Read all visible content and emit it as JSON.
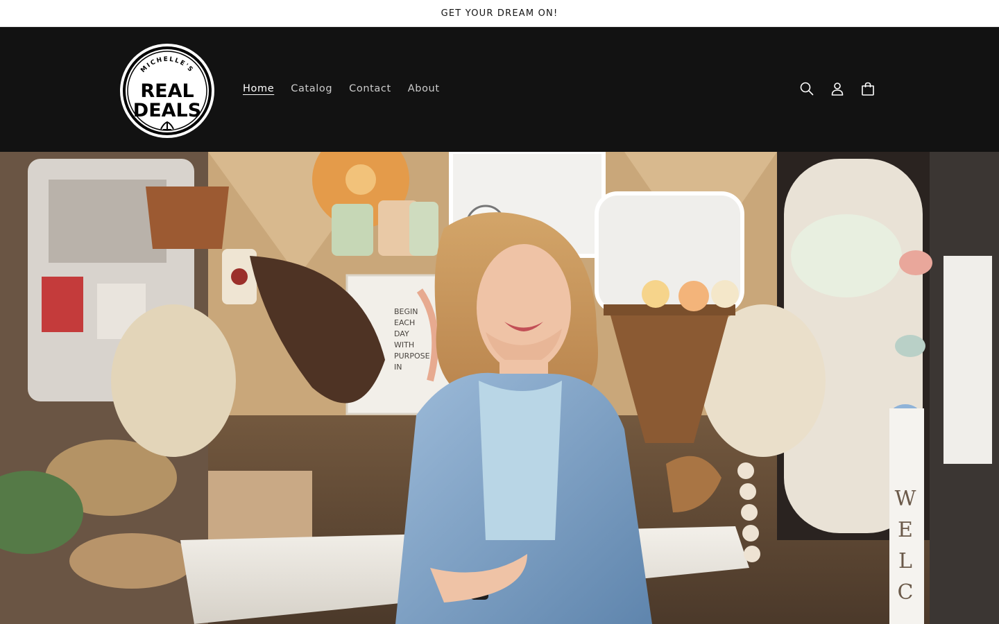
{
  "announcement": {
    "text": "GET YOUR DREAM ON!"
  },
  "header": {
    "logo": {
      "top_text": "MICHELLE'S",
      "line1": "REAL",
      "line2": "DEALS"
    },
    "nav": [
      {
        "label": "Home",
        "active": true
      },
      {
        "label": "Catalog",
        "active": false
      },
      {
        "label": "Contact",
        "active": false
      },
      {
        "label": "About",
        "active": false
      }
    ],
    "icons": [
      "search-icon",
      "account-icon",
      "cart-icon"
    ]
  },
  "hero": {
    "sign_text": [
      "BEGIN",
      "EACH",
      "DAY",
      "WITH",
      "PURPOSE",
      "IN"
    ],
    "welcome_letters": [
      "W",
      "E",
      "L",
      "C"
    ]
  },
  "colors": {
    "header_bg": "#121212",
    "announcement_bg": "#ffffff",
    "denim": "#7fa3c8"
  }
}
